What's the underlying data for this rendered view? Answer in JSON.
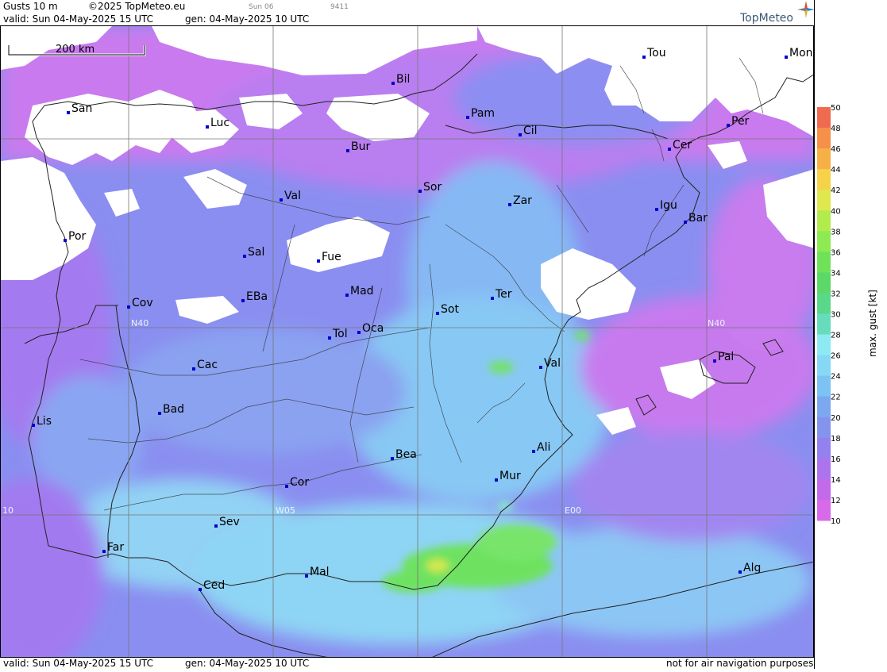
{
  "header": {
    "product": "Gusts 10 m",
    "copyright": "©2025 TopMeteo.eu",
    "valid": "valid:  Sun  04-May-2025  15 UTC",
    "generated": "gen: 04-May-2025 10 UTC",
    "run_day": "Sun 06",
    "code": "9411",
    "brand": "TopMeteo"
  },
  "footer": {
    "valid": "valid:  Sun  04-May-2025  15 UTC",
    "generated": "gen: 04-May-2025 10 UTC",
    "disclaimer": "not for air navigation purposes"
  },
  "scale_bar": {
    "label": "200 km"
  },
  "grid_labels": {
    "lat40_left": "N40",
    "lat40_right": "N40",
    "lon_w10": "10",
    "lon_w05": "W05",
    "lon_e00": "E00"
  },
  "legend": {
    "title": "max. gust  [kt]",
    "ticks": [
      "50",
      "48",
      "46",
      "44",
      "42",
      "40",
      "38",
      "36",
      "34",
      "32",
      "30",
      "28",
      "26",
      "24",
      "22",
      "20",
      "18",
      "16",
      "14",
      "12",
      "10"
    ],
    "colors": [
      "#f06a50",
      "#f4904a",
      "#f6b046",
      "#f6d24a",
      "#dfe84c",
      "#b2ec4c",
      "#8eea52",
      "#70e25a",
      "#5cd868",
      "#5ad88a",
      "#66dcbc",
      "#8eeaf2",
      "#86d8f4",
      "#7cc2f2",
      "#7ca8f0",
      "#8494ee",
      "#9480ee",
      "#ac74ec",
      "#c26aea",
      "#d86aea"
    ]
  },
  "cities": [
    {
      "name": "Tou"
    },
    {
      "name": "Mon"
    },
    {
      "name": "Bil"
    },
    {
      "name": "San"
    },
    {
      "name": "Luc"
    },
    {
      "name": "Pam"
    },
    {
      "name": "Cil"
    },
    {
      "name": "Per"
    },
    {
      "name": "Bur"
    },
    {
      "name": "Cer"
    },
    {
      "name": "Sor"
    },
    {
      "name": "Val"
    },
    {
      "name": "Zar"
    },
    {
      "name": "Igu"
    },
    {
      "name": "Bar"
    },
    {
      "name": "Por"
    },
    {
      "name": "Sal"
    },
    {
      "name": "Fue"
    },
    {
      "name": "Mad"
    },
    {
      "name": "Cov"
    },
    {
      "name": "EBa"
    },
    {
      "name": "Ter"
    },
    {
      "name": "Sot"
    },
    {
      "name": "Tol"
    },
    {
      "name": "Oca"
    },
    {
      "name": "Val"
    },
    {
      "name": "Pal"
    },
    {
      "name": "Cac"
    },
    {
      "name": "Bad"
    },
    {
      "name": "Lis"
    },
    {
      "name": "Ali"
    },
    {
      "name": "Bea"
    },
    {
      "name": "Mur"
    },
    {
      "name": "Cor"
    },
    {
      "name": "Sev"
    },
    {
      "name": "Far"
    },
    {
      "name": "Mal"
    },
    {
      "name": "Ced"
    },
    {
      "name": "Alg"
    }
  ]
}
